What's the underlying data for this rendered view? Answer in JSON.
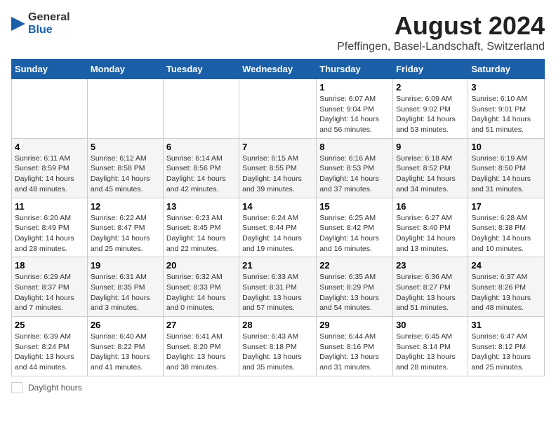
{
  "header": {
    "logo_general": "General",
    "logo_blue": "Blue",
    "month": "August 2024",
    "location": "Pfeffingen, Basel-Landschaft, Switzerland"
  },
  "weekdays": [
    "Sunday",
    "Monday",
    "Tuesday",
    "Wednesday",
    "Thursday",
    "Friday",
    "Saturday"
  ],
  "weeks": [
    [
      {
        "day": "",
        "info": ""
      },
      {
        "day": "",
        "info": ""
      },
      {
        "day": "",
        "info": ""
      },
      {
        "day": "",
        "info": ""
      },
      {
        "day": "1",
        "info": "Sunrise: 6:07 AM\nSunset: 9:04 PM\nDaylight: 14 hours\nand 56 minutes."
      },
      {
        "day": "2",
        "info": "Sunrise: 6:09 AM\nSunset: 9:02 PM\nDaylight: 14 hours\nand 53 minutes."
      },
      {
        "day": "3",
        "info": "Sunrise: 6:10 AM\nSunset: 9:01 PM\nDaylight: 14 hours\nand 51 minutes."
      }
    ],
    [
      {
        "day": "4",
        "info": "Sunrise: 6:11 AM\nSunset: 8:59 PM\nDaylight: 14 hours\nand 48 minutes."
      },
      {
        "day": "5",
        "info": "Sunrise: 6:12 AM\nSunset: 8:58 PM\nDaylight: 14 hours\nand 45 minutes."
      },
      {
        "day": "6",
        "info": "Sunrise: 6:14 AM\nSunset: 8:56 PM\nDaylight: 14 hours\nand 42 minutes."
      },
      {
        "day": "7",
        "info": "Sunrise: 6:15 AM\nSunset: 8:55 PM\nDaylight: 14 hours\nand 39 minutes."
      },
      {
        "day": "8",
        "info": "Sunrise: 6:16 AM\nSunset: 8:53 PM\nDaylight: 14 hours\nand 37 minutes."
      },
      {
        "day": "9",
        "info": "Sunrise: 6:18 AM\nSunset: 8:52 PM\nDaylight: 14 hours\nand 34 minutes."
      },
      {
        "day": "10",
        "info": "Sunrise: 6:19 AM\nSunset: 8:50 PM\nDaylight: 14 hours\nand 31 minutes."
      }
    ],
    [
      {
        "day": "11",
        "info": "Sunrise: 6:20 AM\nSunset: 8:49 PM\nDaylight: 14 hours\nand 28 minutes."
      },
      {
        "day": "12",
        "info": "Sunrise: 6:22 AM\nSunset: 8:47 PM\nDaylight: 14 hours\nand 25 minutes."
      },
      {
        "day": "13",
        "info": "Sunrise: 6:23 AM\nSunset: 8:45 PM\nDaylight: 14 hours\nand 22 minutes."
      },
      {
        "day": "14",
        "info": "Sunrise: 6:24 AM\nSunset: 8:44 PM\nDaylight: 14 hours\nand 19 minutes."
      },
      {
        "day": "15",
        "info": "Sunrise: 6:25 AM\nSunset: 8:42 PM\nDaylight: 14 hours\nand 16 minutes."
      },
      {
        "day": "16",
        "info": "Sunrise: 6:27 AM\nSunset: 8:40 PM\nDaylight: 14 hours\nand 13 minutes."
      },
      {
        "day": "17",
        "info": "Sunrise: 6:28 AM\nSunset: 8:38 PM\nDaylight: 14 hours\nand 10 minutes."
      }
    ],
    [
      {
        "day": "18",
        "info": "Sunrise: 6:29 AM\nSunset: 8:37 PM\nDaylight: 14 hours\nand 7 minutes."
      },
      {
        "day": "19",
        "info": "Sunrise: 6:31 AM\nSunset: 8:35 PM\nDaylight: 14 hours\nand 3 minutes."
      },
      {
        "day": "20",
        "info": "Sunrise: 6:32 AM\nSunset: 8:33 PM\nDaylight: 14 hours\nand 0 minutes."
      },
      {
        "day": "21",
        "info": "Sunrise: 6:33 AM\nSunset: 8:31 PM\nDaylight: 13 hours\nand 57 minutes."
      },
      {
        "day": "22",
        "info": "Sunrise: 6:35 AM\nSunset: 8:29 PM\nDaylight: 13 hours\nand 54 minutes."
      },
      {
        "day": "23",
        "info": "Sunrise: 6:36 AM\nSunset: 8:27 PM\nDaylight: 13 hours\nand 51 minutes."
      },
      {
        "day": "24",
        "info": "Sunrise: 6:37 AM\nSunset: 8:26 PM\nDaylight: 13 hours\nand 48 minutes."
      }
    ],
    [
      {
        "day": "25",
        "info": "Sunrise: 6:39 AM\nSunset: 8:24 PM\nDaylight: 13 hours\nand 44 minutes."
      },
      {
        "day": "26",
        "info": "Sunrise: 6:40 AM\nSunset: 8:22 PM\nDaylight: 13 hours\nand 41 minutes."
      },
      {
        "day": "27",
        "info": "Sunrise: 6:41 AM\nSunset: 8:20 PM\nDaylight: 13 hours\nand 38 minutes."
      },
      {
        "day": "28",
        "info": "Sunrise: 6:43 AM\nSunset: 8:18 PM\nDaylight: 13 hours\nand 35 minutes."
      },
      {
        "day": "29",
        "info": "Sunrise: 6:44 AM\nSunset: 8:16 PM\nDaylight: 13 hours\nand 31 minutes."
      },
      {
        "day": "30",
        "info": "Sunrise: 6:45 AM\nSunset: 8:14 PM\nDaylight: 13 hours\nand 28 minutes."
      },
      {
        "day": "31",
        "info": "Sunrise: 6:47 AM\nSunset: 8:12 PM\nDaylight: 13 hours\nand 25 minutes."
      }
    ]
  ],
  "legend": {
    "label": "Daylight hours"
  }
}
